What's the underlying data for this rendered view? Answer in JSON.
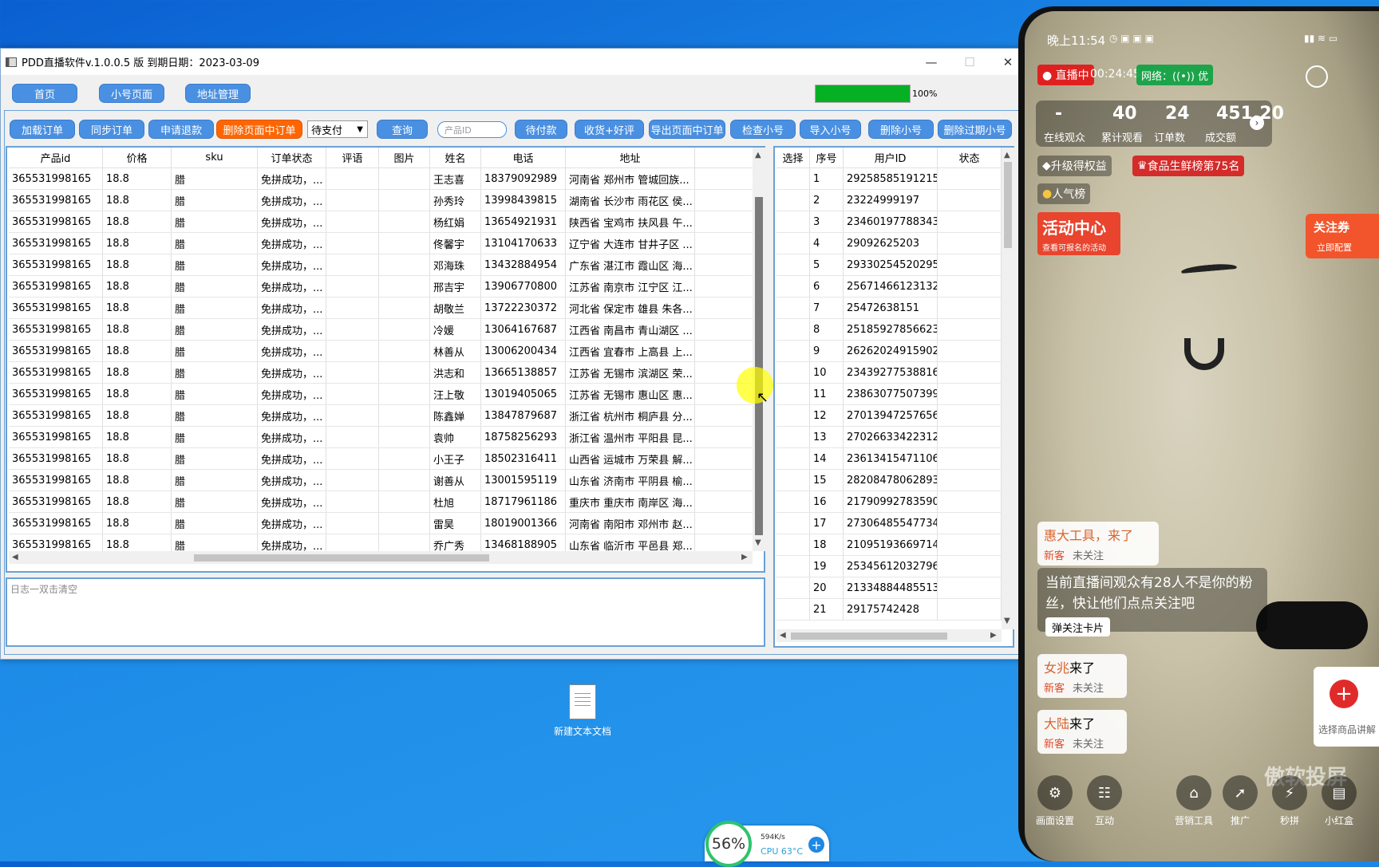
{
  "window": {
    "title": "PDD直播软件v.1.0.0.5 版  到期日期：2023-03-09",
    "minimize": "—",
    "maximize": "☐",
    "close": "✕"
  },
  "nav": {
    "home": "首页",
    "accounts": "小号页面",
    "address": "地址管理"
  },
  "progress": {
    "value": 1.0,
    "label": "100%"
  },
  "toolbar": {
    "load": "加载订单",
    "sync": "同步订单",
    "refund": "申请退款",
    "delete_page": "删除页面中订单",
    "status_select": "待支付",
    "query": "查询",
    "product_placeholder": "产品ID",
    "pending_pay": "待付款",
    "receive_review": "收货+好评",
    "export": "导出页面中订单",
    "check": "检查小号",
    "import": "导入小号",
    "delete_acc": "删除小号",
    "delete_expired": "删除过期小号"
  },
  "orders": {
    "columns": [
      "产品id",
      "价格",
      "sku",
      "订单状态",
      "评语",
      "图片",
      "姓名",
      "电话",
      "地址"
    ],
    "rows": [
      [
        "365531998165",
        "18.8",
        "腊",
        "免拼成功，...",
        "",
        "",
        "王志喜",
        "18379092989",
        "河南省 郑州市 管城回族..."
      ],
      [
        "365531998165",
        "18.8",
        "腊",
        "免拼成功，...",
        "",
        "",
        "孙秀玲",
        "13998439815",
        "湖南省 长沙市 雨花区 侯..."
      ],
      [
        "365531998165",
        "18.8",
        "腊",
        "免拼成功，...",
        "",
        "",
        "杨红娟",
        "13654921931",
        "陕西省 宝鸡市 扶风县 午..."
      ],
      [
        "365531998165",
        "18.8",
        "腊",
        "免拼成功，...",
        "",
        "",
        "佟馨宇",
        "13104170633",
        "辽宁省 大连市 甘井子区 ..."
      ],
      [
        "365531998165",
        "18.8",
        "腊",
        "免拼成功，...",
        "",
        "",
        "邓海珠",
        "13432884954",
        "广东省 湛江市 霞山区 海..."
      ],
      [
        "365531998165",
        "18.8",
        "腊",
        "免拼成功，...",
        "",
        "",
        "邢吉宇",
        "13906770800",
        "江苏省 南京市 江宁区 江..."
      ],
      [
        "365531998165",
        "18.8",
        "腊",
        "免拼成功，...",
        "",
        "",
        "胡敬兰",
        "13722230372",
        "河北省 保定市 雄县 朱各..."
      ],
      [
        "365531998165",
        "18.8",
        "腊",
        "免拼成功，...",
        "",
        "",
        "冷媛",
        "13064167687",
        "江西省 南昌市 青山湖区 ..."
      ],
      [
        "365531998165",
        "18.8",
        "腊",
        "免拼成功，...",
        "",
        "",
        "林善从",
        "13006200434",
        "江西省 宜春市 上高县 上..."
      ],
      [
        "365531998165",
        "18.8",
        "腊",
        "免拼成功，...",
        "",
        "",
        "洪志和",
        "13665138857",
        "江苏省 无锡市 滨湖区 荣..."
      ],
      [
        "365531998165",
        "18.8",
        "腊",
        "免拼成功，...",
        "",
        "",
        "汪上敬",
        "13019405065",
        "江苏省 无锡市 惠山区 惠..."
      ],
      [
        "365531998165",
        "18.8",
        "腊",
        "免拼成功，...",
        "",
        "",
        "陈鑫婵",
        "13847879687",
        "浙江省 杭州市 桐庐县 分..."
      ],
      [
        "365531998165",
        "18.8",
        "腊",
        "免拼成功，...",
        "",
        "",
        "袁帅",
        "18758256293",
        "浙江省 温州市 平阳县 昆..."
      ],
      [
        "365531998165",
        "18.8",
        "腊",
        "免拼成功，...",
        "",
        "",
        "小王子",
        "18502316411",
        "山西省 运城市 万荣县 解..."
      ],
      [
        "365531998165",
        "18.8",
        "腊",
        "免拼成功，...",
        "",
        "",
        "谢善从",
        "13001595119",
        "山东省 济南市 平阴县 榆..."
      ],
      [
        "365531998165",
        "18.8",
        "腊",
        "免拼成功，...",
        "",
        "",
        "杜旭",
        "18717961186",
        "重庆市 重庆市 南岸区 海..."
      ],
      [
        "365531998165",
        "18.8",
        "腊",
        "免拼成功，...",
        "",
        "",
        "雷昊",
        "18019001366",
        "河南省 南阳市 邓州市 赵..."
      ],
      [
        "365531998165",
        "18.8",
        "腊",
        "免拼成功，...",
        "",
        "",
        "乔广秀",
        "13468188905",
        "山东省 临沂市 平邑县 郑..."
      ]
    ]
  },
  "log": {
    "placeholder": "日志一双击清空"
  },
  "accounts": {
    "columns": [
      "选择",
      "序号",
      "用户ID",
      "状态"
    ],
    "rows": [
      [
        "",
        "1",
        "29258585191215",
        ""
      ],
      [
        "",
        "2",
        "23224999197",
        ""
      ],
      [
        "",
        "3",
        "23460197788343",
        ""
      ],
      [
        "",
        "4",
        "29092625203",
        ""
      ],
      [
        "",
        "5",
        "29330254520295",
        ""
      ],
      [
        "",
        "6",
        "25671466123132",
        ""
      ],
      [
        "",
        "7",
        "25472638151",
        ""
      ],
      [
        "",
        "8",
        "25185927856623",
        ""
      ],
      [
        "",
        "9",
        "26262024915902",
        ""
      ],
      [
        "",
        "10",
        "23439277538816",
        ""
      ],
      [
        "",
        "11",
        "23863077507399",
        ""
      ],
      [
        "",
        "12",
        "27013947257656",
        ""
      ],
      [
        "",
        "13",
        "27026633422312",
        ""
      ],
      [
        "",
        "14",
        "23613415471106",
        ""
      ],
      [
        "",
        "15",
        "28208478062893",
        ""
      ],
      [
        "",
        "16",
        "21790992783590",
        ""
      ],
      [
        "",
        "17",
        "27306485547734",
        ""
      ],
      [
        "",
        "18",
        "21095193669714",
        ""
      ],
      [
        "",
        "19",
        "25345612032796",
        ""
      ],
      [
        "",
        "20",
        "21334884485513",
        ""
      ],
      [
        "",
        "21",
        "29175742428",
        ""
      ]
    ]
  },
  "desktop": {
    "file_label": "新建文本文档",
    "meter_pct": "56%",
    "net_speed": "594K/s",
    "cpu": "CPU 63°C"
  },
  "phone": {
    "time": "晚上11:54",
    "live_badge": "● 直播中",
    "duration": "00:24:45",
    "network": "网络：((•)) 优",
    "stats": [
      {
        "value": "-",
        "label": "在线观众"
      },
      {
        "value": "40",
        "label": "累计观看"
      },
      {
        "value": "24",
        "label": "订单数"
      },
      {
        "value": "451.20",
        "label": "成交额"
      }
    ],
    "upgrade": "升级得权益",
    "rank": "食品生鲜榜第75名",
    "popular": "人气榜",
    "activity_title": "活动中心",
    "activity_sub": "查看可报名的活动",
    "follow_coupon": "关注券",
    "follow_sub": "立即配置",
    "comment1": {
      "name": "惠大工具，来了",
      "tags": [
        "新客",
        "未关注"
      ]
    },
    "notice": "当前直播间观众有28人不是你的粉丝，快让他们点点关注吧",
    "notice_btn": "弹关注卡片",
    "comment2": {
      "name": "女兆",
      "suffix": "来了",
      "tags": [
        "新客",
        "未关注"
      ]
    },
    "comment3": {
      "name": "大陆",
      "suffix": "来了",
      "tags": [
        "新客",
        "未关注"
      ]
    },
    "add_product": "选择商品讲解",
    "bottom": [
      "画面设置",
      "互动",
      "营销工具",
      "推广",
      "秒拼",
      "小红盒"
    ],
    "watermark": "傲软投屏"
  }
}
